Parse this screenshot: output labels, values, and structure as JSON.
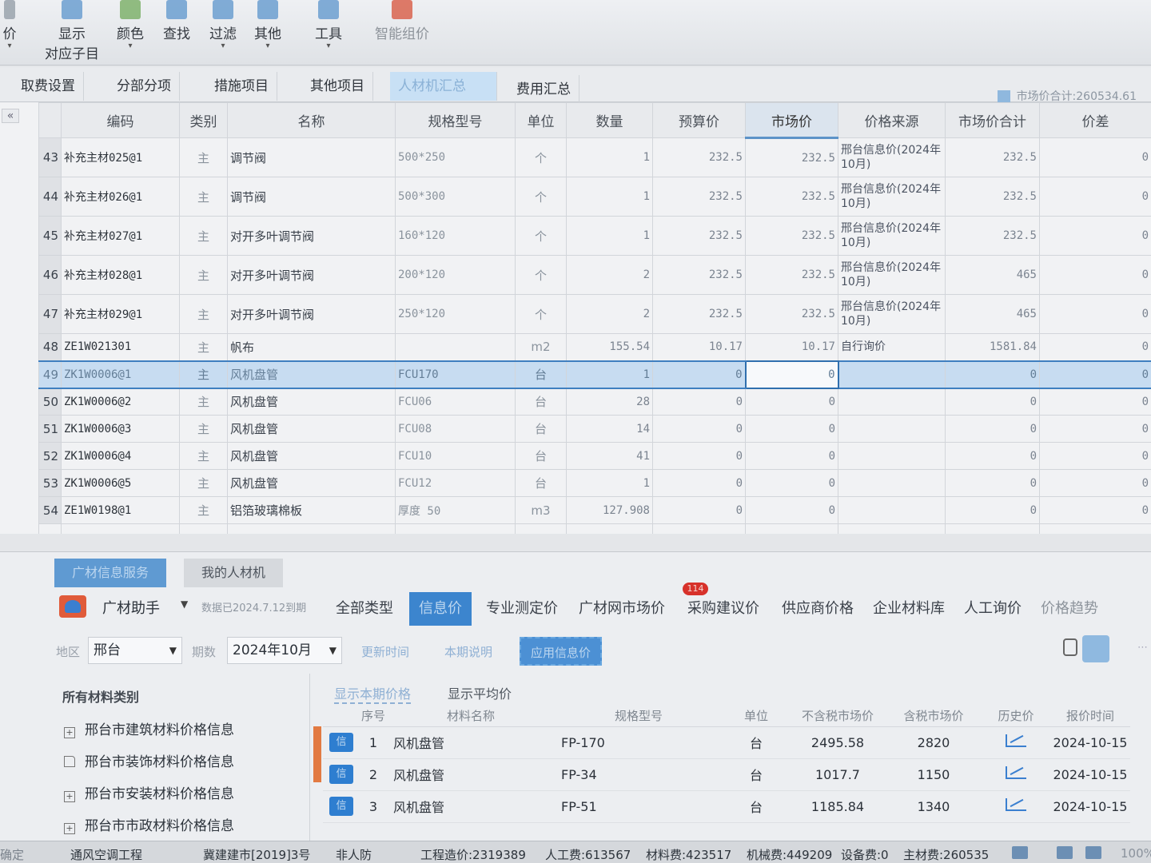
{
  "ribbon": {
    "first_item": "价",
    "items": [
      {
        "label": "显示",
        "sub": "对应子目",
        "icon": "show-items-icon",
        "caret": false
      },
      {
        "label": "颜色",
        "icon": "color-icon",
        "caret": true
      },
      {
        "label": "查找",
        "icon": "search-icon",
        "caret": false
      },
      {
        "label": "过滤",
        "icon": "filter-icon",
        "caret": true
      },
      {
        "label": "其他",
        "icon": "other-icon",
        "caret": true
      },
      {
        "label": "工具",
        "icon": "tools-icon",
        "caret": true
      },
      {
        "label": "智能组价",
        "icon": "smart-pricing-icon",
        "caret": false
      }
    ]
  },
  "main_tabs": [
    "取费设置",
    "分部分项",
    "措施项目",
    "其他项目",
    "人材机汇总",
    "费用汇总"
  ],
  "market_total_label": "市场价合计:260534.61",
  "grid": {
    "columns": [
      "编码",
      "类别",
      "名称",
      "规格型号",
      "单位",
      "数量",
      "预算价",
      "市场价",
      "价格来源",
      "市场价合计",
      "价差"
    ],
    "rows": [
      {
        "no": "43",
        "code": "补充主材025@1",
        "type": "主",
        "name": "调节阀",
        "spec": "500*250",
        "unit": "个",
        "qty": "1",
        "budget": "232.5",
        "market": "232.5",
        "source": "邢台信息价(2024年10月)",
        "total": "232.5",
        "diff": "0"
      },
      {
        "no": "44",
        "code": "补充主材026@1",
        "type": "主",
        "name": "调节阀",
        "spec": "500*300",
        "unit": "个",
        "qty": "1",
        "budget": "232.5",
        "market": "232.5",
        "source": "邢台信息价(2024年10月)",
        "total": "232.5",
        "diff": "0"
      },
      {
        "no": "45",
        "code": "补充主材027@1",
        "type": "主",
        "name": "对开多叶调节阀",
        "spec": "160*120",
        "unit": "个",
        "qty": "1",
        "budget": "232.5",
        "market": "232.5",
        "source": "邢台信息价(2024年10月)",
        "total": "232.5",
        "diff": "0"
      },
      {
        "no": "46",
        "code": "补充主材028@1",
        "type": "主",
        "name": "对开多叶调节阀",
        "spec": "200*120",
        "unit": "个",
        "qty": "2",
        "budget": "232.5",
        "market": "232.5",
        "source": "邢台信息价(2024年10月)",
        "total": "465",
        "diff": "0"
      },
      {
        "no": "47",
        "code": "补充主材029@1",
        "type": "主",
        "name": "对开多叶调节阀",
        "spec": "250*120",
        "unit": "个",
        "qty": "2",
        "budget": "232.5",
        "market": "232.5",
        "source": "邢台信息价(2024年10月)",
        "total": "465",
        "diff": "0"
      },
      {
        "no": "48",
        "code": "ZE1W021301",
        "type": "主",
        "name": "帆布",
        "spec": "",
        "unit": "m2",
        "qty": "155.54",
        "budget": "10.17",
        "market": "10.17",
        "source": "自行询价",
        "total": "1581.84",
        "diff": "0"
      },
      {
        "no": "49",
        "code": "ZK1W0006@1",
        "type": "主",
        "name": "风机盘管",
        "spec": "FCU170",
        "unit": "台",
        "qty": "1",
        "budget": "0",
        "market": "0",
        "source": "",
        "total": "0",
        "diff": "0"
      },
      {
        "no": "50",
        "code": "ZK1W0006@2",
        "type": "主",
        "name": "风机盘管",
        "spec": "FCU06",
        "unit": "台",
        "qty": "28",
        "budget": "0",
        "market": "0",
        "source": "",
        "total": "0",
        "diff": "0"
      },
      {
        "no": "51",
        "code": "ZK1W0006@3",
        "type": "主",
        "name": "风机盘管",
        "spec": "FCU08",
        "unit": "台",
        "qty": "14",
        "budget": "0",
        "market": "0",
        "source": "",
        "total": "0",
        "diff": "0"
      },
      {
        "no": "52",
        "code": "ZK1W0006@4",
        "type": "主",
        "name": "风机盘管",
        "spec": "FCU10",
        "unit": "台",
        "qty": "41",
        "budget": "0",
        "market": "0",
        "source": "",
        "total": "0",
        "diff": "0"
      },
      {
        "no": "53",
        "code": "ZK1W0006@5",
        "type": "主",
        "name": "风机盘管",
        "spec": "FCU12",
        "unit": "台",
        "qty": "1",
        "budget": "0",
        "market": "0",
        "source": "",
        "total": "0",
        "diff": "0"
      },
      {
        "no": "54",
        "code": "ZE1W0198@1",
        "type": "主",
        "name": "铝箔玻璃棉板",
        "spec": "厚度 50",
        "unit": "m3",
        "qty": "127.908",
        "budget": "0",
        "market": "0",
        "source": "",
        "total": "0",
        "diff": "0"
      }
    ]
  },
  "panel": {
    "tabs": [
      "广材信息服务",
      "我的人材机"
    ],
    "assistant_name": "广材助手",
    "data_date": "数据已2024.7.12到期",
    "categories": [
      "全部类型",
      "信息价",
      "专业测定价",
      "广材网市场价",
      "采购建议价",
      "供应商价格",
      "企业材料库",
      "人工询价",
      "价格趋势"
    ],
    "badge": "114",
    "region_label": "地区",
    "region_value": "邢台",
    "period_label": "期数",
    "period_value": "2024年10月",
    "link_update": "更新时间",
    "link_period": "本期说明",
    "btn_apply": "应用信息价",
    "tree_title": "所有材料类别",
    "tree": [
      "邢台市建筑材料价格信息",
      "邢台市装饰材料价格信息",
      "邢台市安装材料价格信息",
      "邢台市市政材料价格信息"
    ],
    "sub_tabs": [
      "显示本期价格",
      "显示平均价"
    ],
    "results_columns": [
      "序号",
      "材料名称",
      "规格型号",
      "单位",
      "不含税市场价",
      "含税市场价",
      "历史价",
      "报价时间"
    ],
    "badge_xin": "信",
    "results": [
      {
        "idx": "1",
        "name": "风机盘管",
        "spec": "FP-170",
        "unit": "台",
        "price_ex": "2495.58",
        "price_in": "2820",
        "date": "2024-10-15"
      },
      {
        "idx": "2",
        "name": "风机盘管",
        "spec": "FP-34",
        "unit": "台",
        "price_ex": "1017.7",
        "price_in": "1150",
        "date": "2024-10-15"
      },
      {
        "idx": "3",
        "name": "风机盘管",
        "spec": "FP-51",
        "unit": "台",
        "price_ex": "1185.84",
        "price_in": "1340",
        "date": "2024-10-15"
      }
    ]
  },
  "status": {
    "left": "确定",
    "project": "通风空调工程",
    "doc": "冀建建市[2019]3号",
    "civil": "非人防",
    "cost": "工程造价:2319389",
    "labor": "人工费:613567",
    "material": "材料费:423517",
    "machine": "机械费:449209",
    "equipment": "设备费:0",
    "main_material": "主材费:260535",
    "zoom": "100%"
  }
}
